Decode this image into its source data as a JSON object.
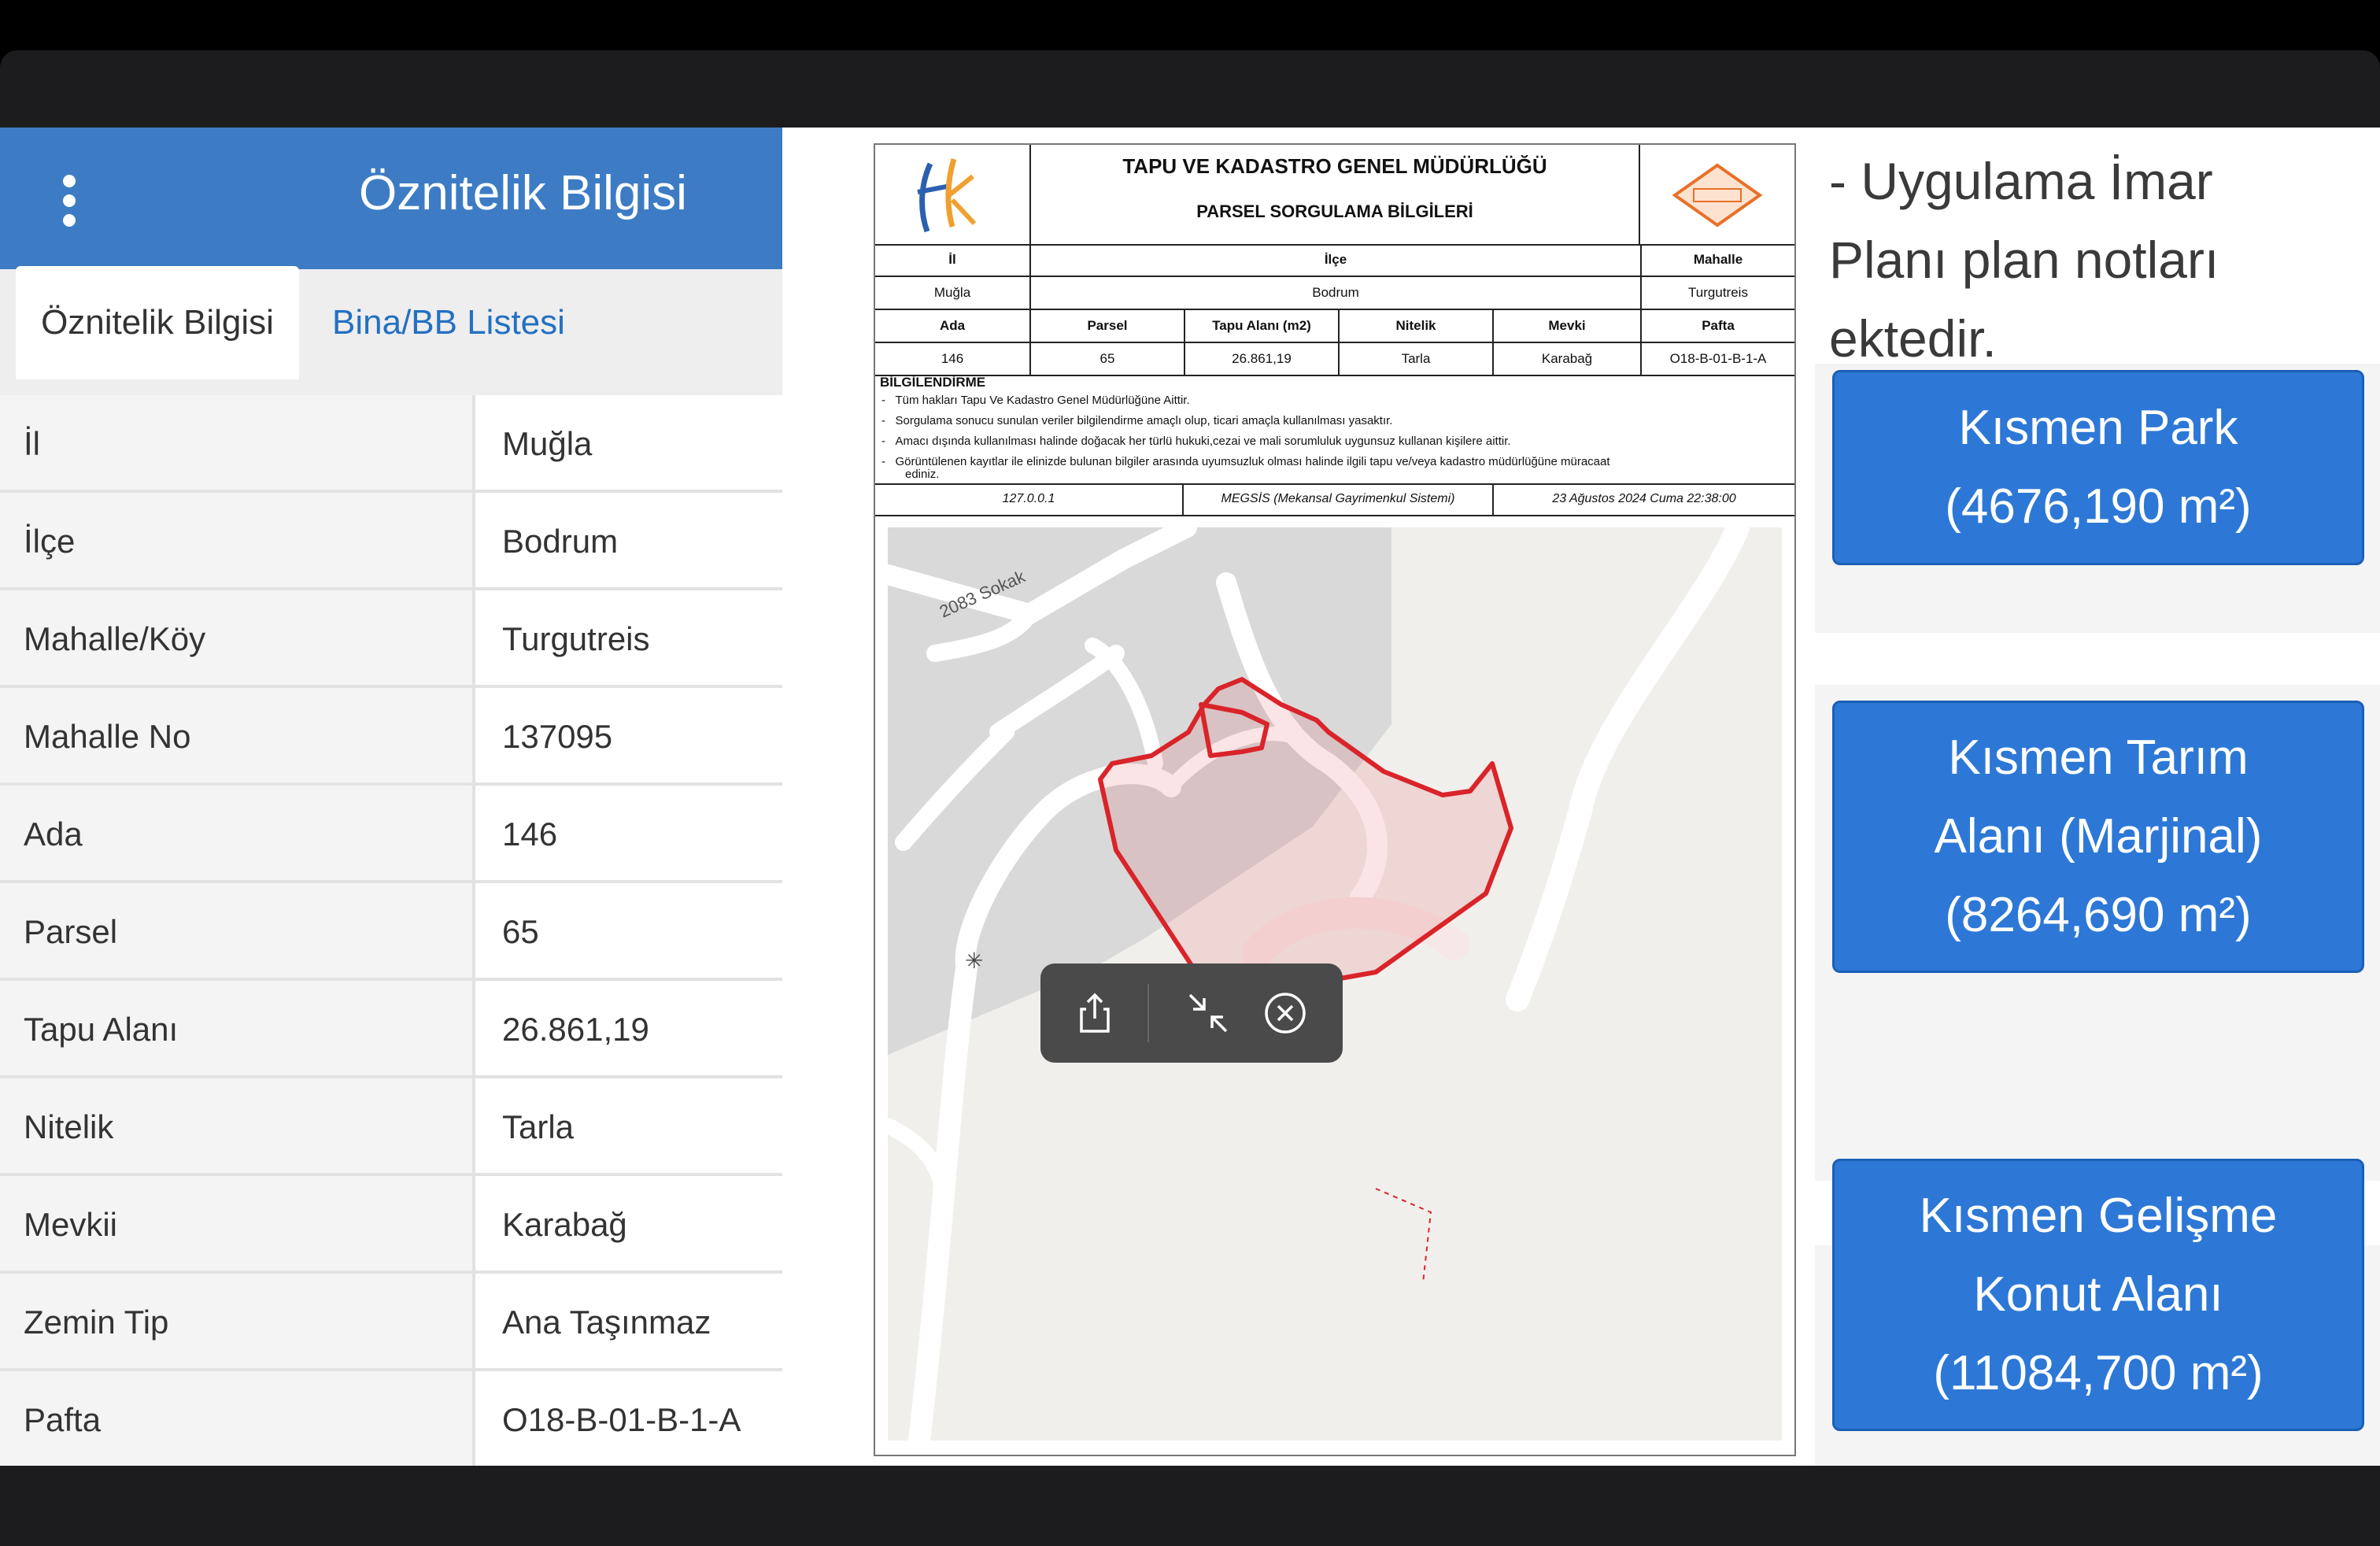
{
  "panel": {
    "header_title": "Öznitelik Bilgisi",
    "tabs": [
      {
        "label": "Öznitelik Bilgisi"
      },
      {
        "label": "Bina/BB Listesi"
      }
    ],
    "rows": [
      {
        "key": "İl",
        "value": "Muğla"
      },
      {
        "key": "İlçe",
        "value": "Bodrum"
      },
      {
        "key": "Mahalle/Köy",
        "value": "Turgutreis"
      },
      {
        "key": "Mahalle No",
        "value": "137095"
      },
      {
        "key": "Ada",
        "value": "146"
      },
      {
        "key": "Parsel",
        "value": "65"
      },
      {
        "key": "Tapu Alanı",
        "value": "26.861,19"
      },
      {
        "key": "Nitelik",
        "value": "Tarla"
      },
      {
        "key": "Mevkii",
        "value": "Karabağ"
      },
      {
        "key": "Zemin Tip",
        "value": "Ana Taşınmaz"
      },
      {
        "key": "Pafta",
        "value": "O18-B-01-B-1-A"
      }
    ]
  },
  "document": {
    "title": "TAPU VE KADASTRO GENEL MÜDÜRLÜĞÜ",
    "subtitle": "PARSEL SORGULAMA BİLGİLERİ",
    "headers1": [
      "İl",
      "İlçe",
      "Mahalle"
    ],
    "values1": [
      "Muğla",
      "Bodrum",
      "Turgutreis"
    ],
    "headers2": [
      "Ada",
      "Parsel",
      "Tapu Alanı (m2)",
      "Nitelik",
      "Mevki",
      "Pafta"
    ],
    "values2": [
      "146",
      "65",
      "26.861,19",
      "Tarla",
      "Karabağ",
      "O18-B-01-B-1-A"
    ],
    "info_title": "BİLGİLENDİRME",
    "info_lines": [
      "Tüm hakları Tapu Ve Kadastro Genel Müdürlüğüne Aittir.",
      "Sorgulama sonucu sunulan veriler bilgilendirme amaçlı olup, ticari amaçla kullanılması yasaktır.",
      "Amacı dışında kullanılması halinde doğacak her türlü hukuki,cezai ve mali sorumluluk uygunsuz kullanan kişilere aittir.",
      "Görüntülenen kayıtlar ile elinizde bulunan bilgiler arasında uyumsuzluk olması halinde ilgili tapu ve/veya kadastro müdürlüğüne müracaat",
      "ediniz."
    ],
    "footer": [
      "127.0.0.1",
      "MEGSİS (Mekansal Gayrimenkul Sistemi)",
      "23 Ağustos 2024 Cuma 22:38:00"
    ],
    "map_street": "2083 Sokak",
    "parcel_color": "#d9242a"
  },
  "notes": {
    "lines": [
      "- Uygulama İmar",
      "Planı plan notları",
      "ektedir."
    ]
  },
  "zones": [
    {
      "lines": [
        "Kısmen Park",
        "(4676,190 m²)"
      ]
    },
    {
      "lines": [
        "Kısmen Tarım",
        "Alanı (Marjinal)",
        "(8264,690 m²)"
      ]
    },
    {
      "lines": [
        "Kısmen Gelişme",
        "Konut Alanı",
        "(11084,700 m²)"
      ]
    }
  ],
  "colors": {
    "header_blue": "#3d7cc4",
    "button_blue": "#2d78d6",
    "link_blue": "#2470c2"
  }
}
